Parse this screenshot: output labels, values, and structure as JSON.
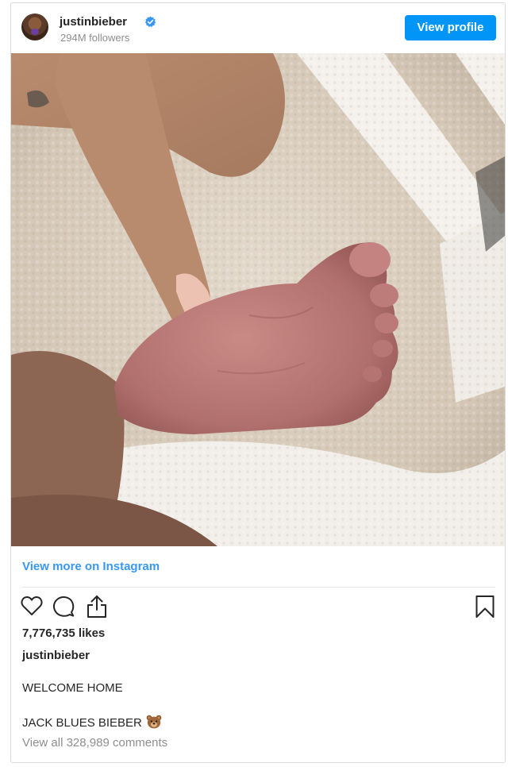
{
  "header": {
    "username": "justinbieber",
    "followers": "294M followers",
    "view_profile_label": "View profile"
  },
  "post": {
    "view_more_label": "View more on Instagram",
    "likes": "7,776,735 likes",
    "caption_user": "justinbieber",
    "caption_lines": [
      "WELCOME HOME",
      "JACK BLUES BIEBER"
    ],
    "comments_link": "View all 328,989 comments"
  },
  "colors": {
    "accent": "#0095f6",
    "link": "#3897f0",
    "verified": "#3897f0",
    "muted": "#8e8e8e"
  },
  "icons": {
    "like": "heart-icon",
    "comment": "comment-bubble-icon",
    "share": "share-upload-icon",
    "save": "bookmark-icon",
    "verified": "verified-badge-icon",
    "emoji": "bear-face-emoji"
  }
}
